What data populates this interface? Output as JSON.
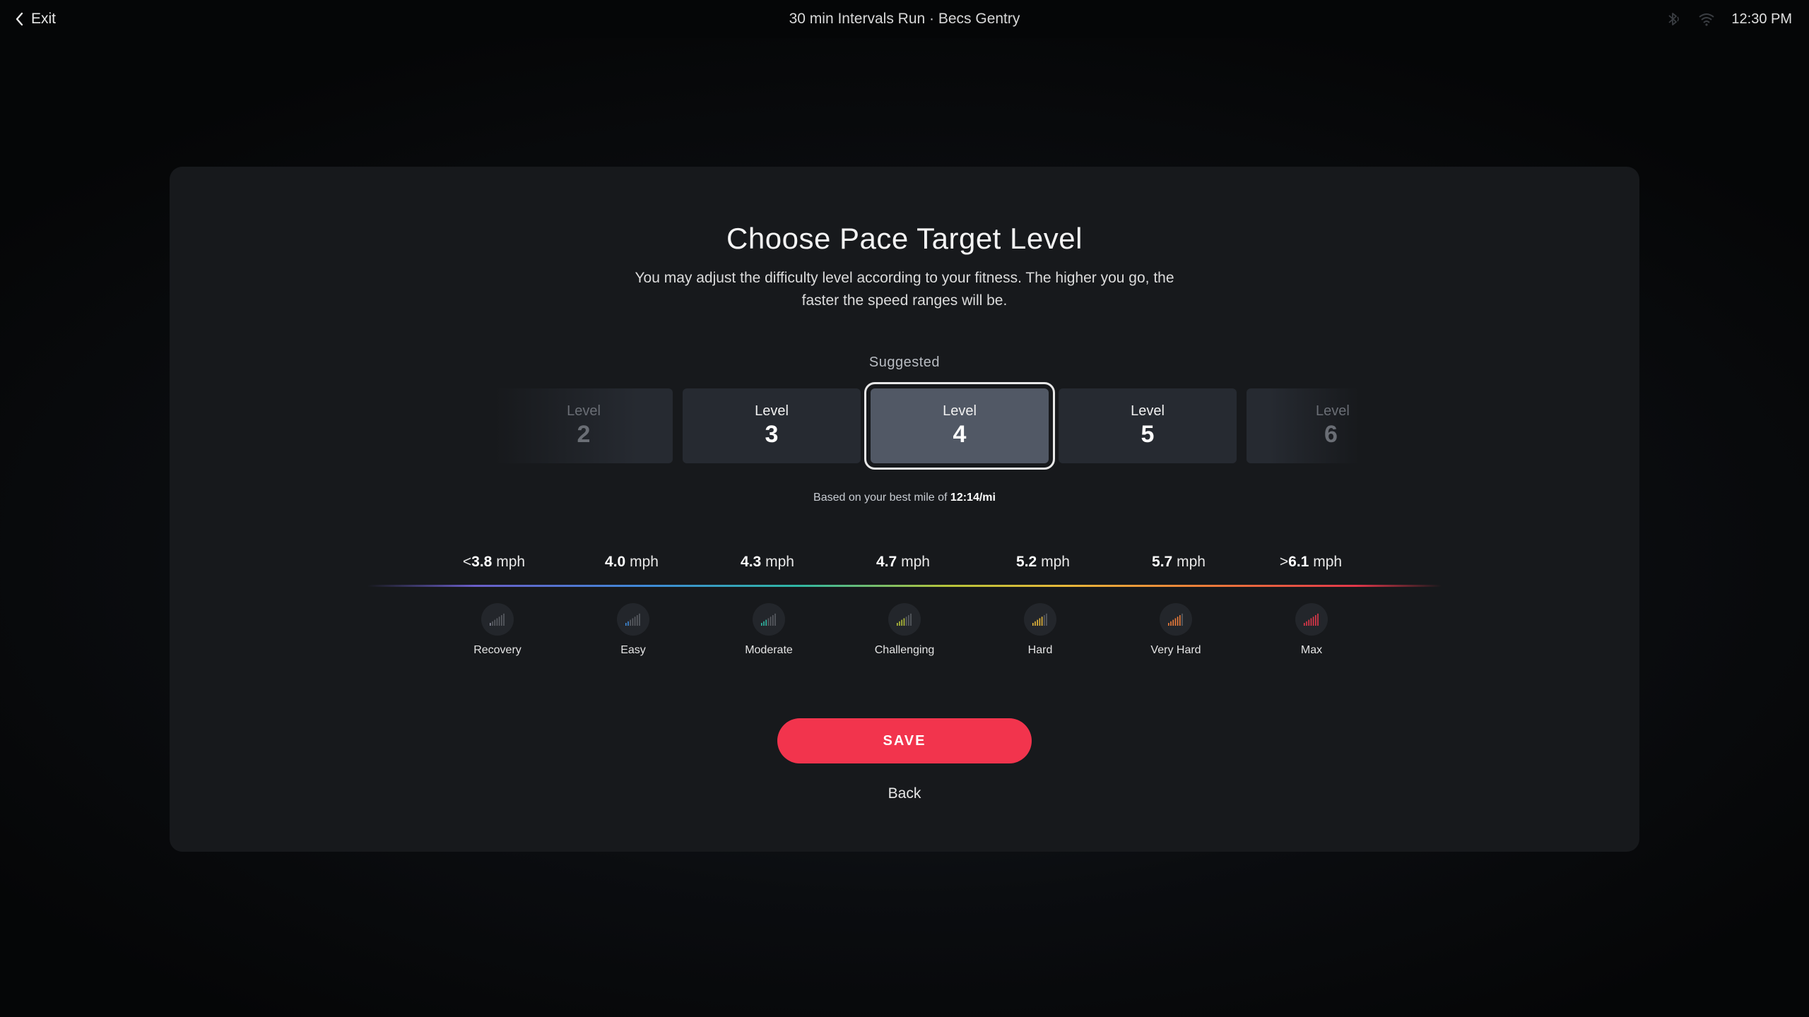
{
  "topbar": {
    "exit_label": "Exit",
    "class_title": "30 min Intervals Run · Becs Gentry",
    "time": "12:30 PM"
  },
  "modal": {
    "title": "Choose Pace Target Level",
    "description": "You may adjust the difficulty level according to your fitness. The higher you go, the faster the speed ranges will be.",
    "suggested_label": "Suggested",
    "levels": [
      {
        "label": "Level",
        "number": "2"
      },
      {
        "label": "Level",
        "number": "3"
      },
      {
        "label": "Level",
        "number": "4"
      },
      {
        "label": "Level",
        "number": "5"
      },
      {
        "label": "Level",
        "number": "6"
      }
    ],
    "selected_level": "4",
    "best_mile_prefix": "Based on your best mile of",
    "best_mile_value": "12:14/mi",
    "speeds": [
      {
        "prefix": "<",
        "value": "3.8",
        "unit": "mph"
      },
      {
        "prefix": "",
        "value": "4.0",
        "unit": "mph"
      },
      {
        "prefix": "",
        "value": "4.3",
        "unit": "mph"
      },
      {
        "prefix": "",
        "value": "4.7",
        "unit": "mph"
      },
      {
        "prefix": "",
        "value": "5.2",
        "unit": "mph"
      },
      {
        "prefix": "",
        "value": "5.7",
        "unit": "mph"
      },
      {
        "prefix": ">",
        "value": "6.1",
        "unit": "mph"
      }
    ],
    "zones": [
      {
        "label": "Recovery",
        "color": "#8c8c9c",
        "bars_lit": 1
      },
      {
        "label": "Easy",
        "color": "#3f8ad8",
        "bars_lit": 2
      },
      {
        "label": "Moderate",
        "color": "#2fb7a4",
        "bars_lit": 3
      },
      {
        "label": "Challenging",
        "color": "#b7c43a",
        "bars_lit": 4
      },
      {
        "label": "Hard",
        "color": "#e8b83a",
        "bars_lit": 5
      },
      {
        "label": "Very Hard",
        "color": "#ee7d3a",
        "bars_lit": 6
      },
      {
        "label": "Max",
        "color": "#e2374a",
        "bars_lit": 7
      }
    ],
    "save_label": "SAVE",
    "back_label": "Back"
  },
  "colors": {
    "accent": "#f2344d",
    "modal_bg": "#17191c",
    "card_bg": "#262a31",
    "selected_card_bg": "#515865"
  }
}
